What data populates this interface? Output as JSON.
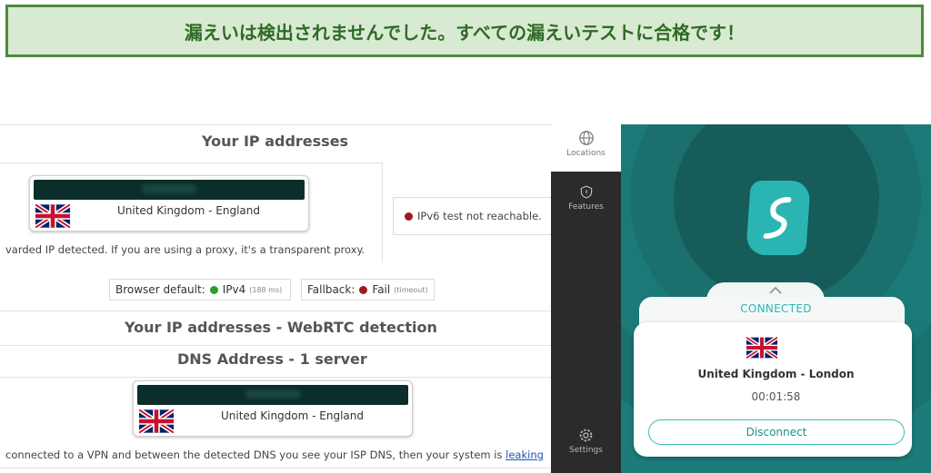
{
  "banner": {
    "text": "漏えいは検出されませんでした。すべての漏えいテストに合格です！"
  },
  "leak_test": {
    "ip_heading": "Your IP addresses",
    "ip_location": "United Kingdom - England",
    "forwarded_note": "varded IP detected. If you are using a proxy, it's a transparent proxy.",
    "ipv6_status": "IPv6 test not reachable.",
    "browser_default": {
      "label": "Browser default:",
      "value": "IPv4",
      "ms": "(188 ms)"
    },
    "fallback": {
      "label": "Fallback:",
      "value": "Fail",
      "note": "(timeout)"
    },
    "webrtc_heading": "Your IP addresses - WebRTC detection",
    "dns_heading": "DNS Address - 1 server",
    "dns_location": "United Kingdom - England",
    "dns_note": "connected to a VPN and between the detected DNS you see your ISP DNS, then your system is",
    "dns_link": "leaking"
  },
  "app": {
    "nav": [
      {
        "label": "Locations",
        "icon": "globe-icon"
      },
      {
        "label": "Features",
        "icon": "shield-icon"
      },
      {
        "label": "Settings",
        "icon": "gear-icon"
      }
    ],
    "status": "CONNECTED",
    "location": "United Kingdom - London",
    "timer": "00:01:58",
    "disconnect_label": "Disconnect"
  },
  "colors": {
    "banner_bg": "#d9ead3",
    "banner_border": "#4e8a3e",
    "accent_teal": "#2bb5b2",
    "ok_green": "#2e9e2e",
    "fail_red": "#9b1c1c"
  }
}
